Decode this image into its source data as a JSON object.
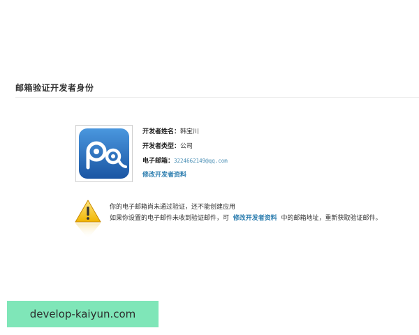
{
  "page": {
    "title": "邮箱验证开发者身份"
  },
  "developer": {
    "name_label": "开发者姓名：",
    "name_value": "韩宝川",
    "type_label": "开发者类型：",
    "type_value": "公司",
    "email_label": "电子邮箱：",
    "email_value": "3224662149@qq.com",
    "edit_link": "修改开发者资料"
  },
  "app_icon": {
    "icon_name": "app-logo-icon",
    "colors": {
      "bg_top": "#3f8bd3",
      "bg_bottom": "#1a55a3",
      "glyph": "#ffffff"
    }
  },
  "notice": {
    "icon_name": "warning-icon",
    "line1": "你的电子邮箱尚未通过验证，还不能创建应用",
    "line2_before": "如果你设置的电子邮件未收到验证邮件，可",
    "line2_link": "修改开发者资料",
    "line2_after": "中的邮箱地址，重新获取验证邮件。"
  },
  "watermark": {
    "text": "develop-kaiyun.com",
    "color": "#7fe6b8"
  },
  "colors": {
    "link": "#2f7fb0",
    "text": "#333333",
    "divider": "#ececec"
  }
}
